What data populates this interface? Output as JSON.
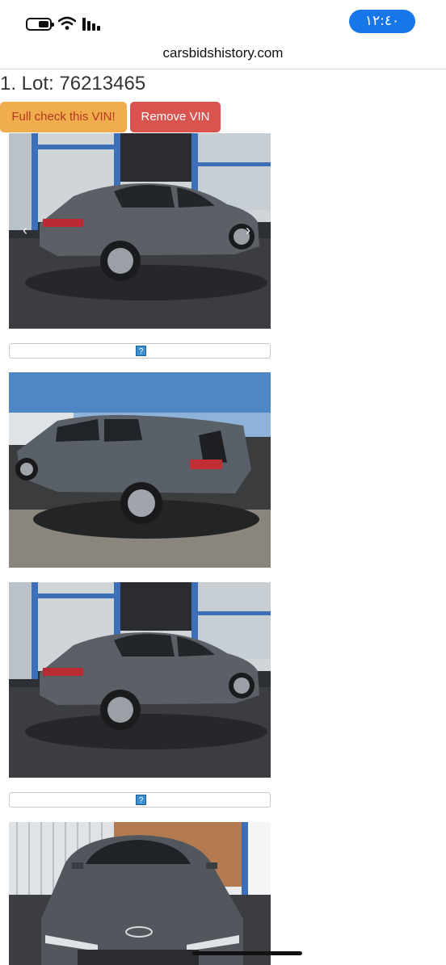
{
  "status_bar": {
    "time": "١٢:٤٠",
    "icons": [
      "battery-icon",
      "wifi-icon",
      "signal-icon"
    ]
  },
  "browser": {
    "address": "carsbidshistory.com"
  },
  "lot": {
    "title": "1. Lot: 76213465",
    "buttons": {
      "full_check": "Full check this VIN!",
      "remove": "Remove VIN"
    }
  },
  "gallery": {
    "help_marker": "?",
    "photos": [
      {
        "name": "rear-left-view"
      },
      {
        "name": "rear-right-view"
      },
      {
        "name": "rear-left-view-2"
      },
      {
        "name": "front-view"
      }
    ]
  },
  "colors": {
    "accent": "#1877e8",
    "warning_button": "#f0ad4e",
    "danger_button": "#d9534f"
  }
}
